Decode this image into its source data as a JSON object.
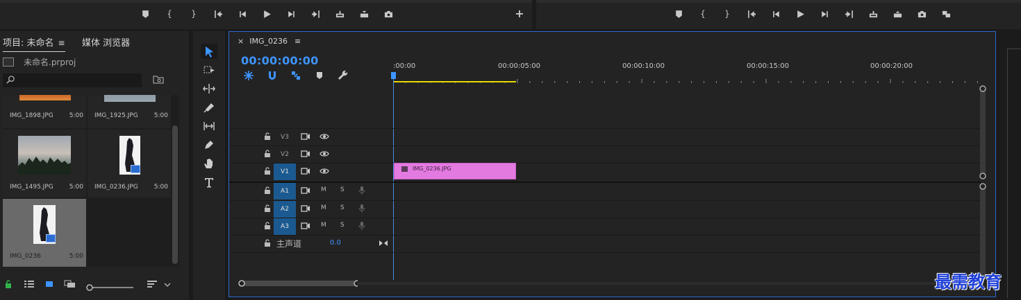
{
  "project_panel": {
    "tab_project": "项目: 未命名",
    "tab_menu": "≡",
    "tab_media_browser": "媒体 浏览器",
    "project_file": "未命名.prproj",
    "search_placeholder": "",
    "items": [
      {
        "name": "IMG_1898.JPG",
        "duration": "5:00"
      },
      {
        "name": "IMG_1925.JPG",
        "duration": "5:00"
      },
      {
        "name": "IMG_1495.JPG",
        "duration": "5:00"
      },
      {
        "name": "IMG_0236.JPG",
        "duration": "5:00"
      },
      {
        "name": "IMG_0236",
        "duration": "5:00"
      }
    ]
  },
  "timeline": {
    "sequence_tab": "IMG_0236",
    "close_glyph": "×",
    "menu_glyph": "≡",
    "timecode": "00:00:00:00",
    "ruler_labels": [
      ":00:00",
      "00:00:05:00",
      "00:00:10:00",
      "00:00:15:00",
      "00:00:20:00"
    ],
    "video_tracks": [
      "V3",
      "V2",
      "V1"
    ],
    "audio_tracks": [
      "A1",
      "A2",
      "A3"
    ],
    "mute_label": "M",
    "solo_label": "S",
    "master_label": "主声道",
    "master_value": "0.0",
    "clip_name": "IMG_0236.JPG"
  },
  "watermark": "最需教育",
  "colors": {
    "accent": "#3d95ff",
    "track_target": "#1b5a90",
    "clip": "#e37ae0",
    "work_area": "#e8d900"
  }
}
